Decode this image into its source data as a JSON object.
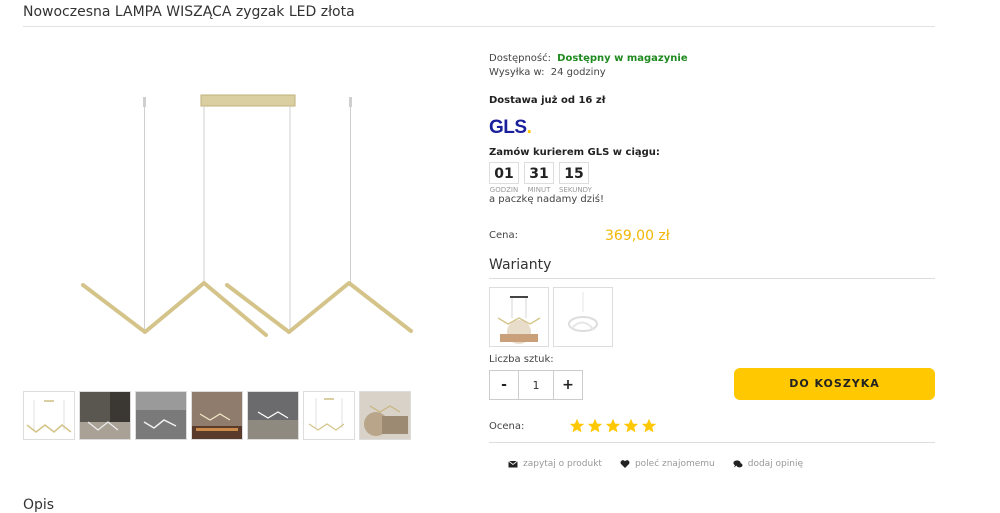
{
  "product": {
    "title": "Nowoczesna LAMPA WISZĄCA zygzak LED złota"
  },
  "availability": {
    "label": "Dostępność:",
    "value": "Dostępny w magazynie",
    "shipping_label": "Wysyłka w:",
    "shipping_value": "24 godziny",
    "delivery": "Dostawa już od 16 zł"
  },
  "courier": {
    "logo_text": "GLS",
    "logo_dot": ".",
    "order_label": "Zamów kurierem GLS w ciągu:",
    "countdown": [
      {
        "value": "01",
        "unit": "GODZIN"
      },
      {
        "value": "31",
        "unit": "MINUT"
      },
      {
        "value": "15",
        "unit": "SEKUNDY"
      }
    ],
    "tagline": "a paczkę nadamy dziś!"
  },
  "price": {
    "label": "Cena:",
    "value": "369,00 zł"
  },
  "variants": {
    "heading": "Warianty"
  },
  "quantity": {
    "label": "Liczba sztuk:",
    "minus": "-",
    "value": "1",
    "plus": "+"
  },
  "cart": {
    "label": "DO KOSZYKA"
  },
  "rating": {
    "label": "Ocena:",
    "stars": 5,
    "max": 5
  },
  "actions": [
    {
      "label": "zapytaj o produkt",
      "icon": "envelope-icon"
    },
    {
      "label": "poleć znajomemu",
      "icon": "heart-icon"
    },
    {
      "label": "dodaj opinię",
      "icon": "comments-icon"
    }
  ],
  "section": {
    "description_heading": "Opis"
  },
  "colors": {
    "accent": "#ffc800",
    "price": "#f2b705",
    "in_stock": "#1f8a1f",
    "gls_blue": "#1a1f9c",
    "lamp_gold": "#d4c48a"
  }
}
